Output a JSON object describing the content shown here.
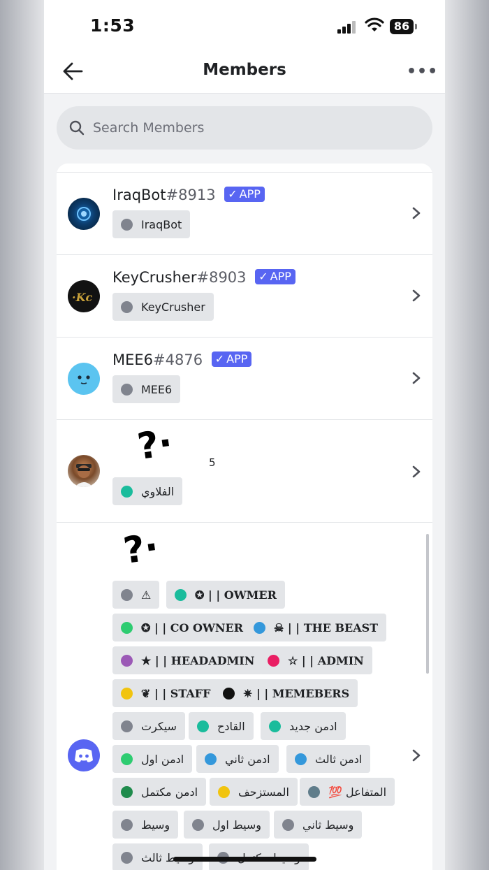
{
  "status_bar": {
    "time": "1:53",
    "battery": "86"
  },
  "header": {
    "title": "Members",
    "more_icon": "more-horizontal-icon",
    "back_icon": "arrow-left-icon"
  },
  "search": {
    "placeholder": "Search Members",
    "value": ""
  },
  "members": [
    {
      "name": "IraqBot",
      "discriminator": "#8913",
      "badge": "APP",
      "roles": [
        {
          "label": "IraqBot",
          "color": "#80848e"
        }
      ]
    },
    {
      "name": "KeyCrusher",
      "discriminator": "#8903",
      "badge": "APP",
      "roles": [
        {
          "label": "KeyCrusher",
          "color": "#80848e"
        }
      ]
    },
    {
      "name": "MEE6",
      "discriminator": "#4876",
      "badge": "APP",
      "roles": [
        {
          "label": "MEE6",
          "color": "#80848e"
        }
      ]
    },
    {
      "name_fragment": "5",
      "roles": [
        {
          "label": "الفلاوي",
          "color": "#1abc9c"
        }
      ]
    },
    {
      "roles": [
        {
          "label": "⚠",
          "color": "#80848e"
        },
        {
          "label": "✪ | | OWMER",
          "color": "#1abc9c"
        },
        {
          "label": "✪ | | CO OWNER",
          "color": "#2ecc71"
        },
        {
          "label": "☠ | | THE BEAST",
          "color": "#3498db"
        },
        {
          "label": "★ | | HEADADMIN",
          "color": "#9b59b6"
        },
        {
          "label": "☆ | | ADMIN",
          "color": "#e91e63"
        },
        {
          "label": "❦ | | STAFF",
          "color": "#f1c40f"
        },
        {
          "label": "✷ | | MEMEBERS",
          "color": "#111111"
        },
        {
          "label": "سيكرت",
          "color": "#80848e"
        },
        {
          "label": "القادح",
          "color": "#1abc9c"
        },
        {
          "label": "ادمن جديد",
          "color": "#1abc9c"
        },
        {
          "label": "ادمن اول",
          "color": "#2ecc71"
        },
        {
          "label": "ادمن ثاني",
          "color": "#3498db"
        },
        {
          "label": "ادمن ثالث",
          "color": "#3498db"
        },
        {
          "label": "ادمن مكتمل",
          "color": "#1f8b4c"
        },
        {
          "label": "المستزحف",
          "color": "#f1c40f"
        },
        {
          "label": "💯 المتفاعل",
          "color": "#607d8b"
        },
        {
          "label": "وسيط",
          "color": "#80848e"
        },
        {
          "label": "وسيط اول",
          "color": "#80848e"
        },
        {
          "label": "وسيط ثاني",
          "color": "#80848e"
        },
        {
          "label": "وسيط ثالث",
          "color": "#80848e"
        },
        {
          "label": "وسيط مكتمل",
          "color": "#80848e"
        }
      ]
    }
  ]
}
